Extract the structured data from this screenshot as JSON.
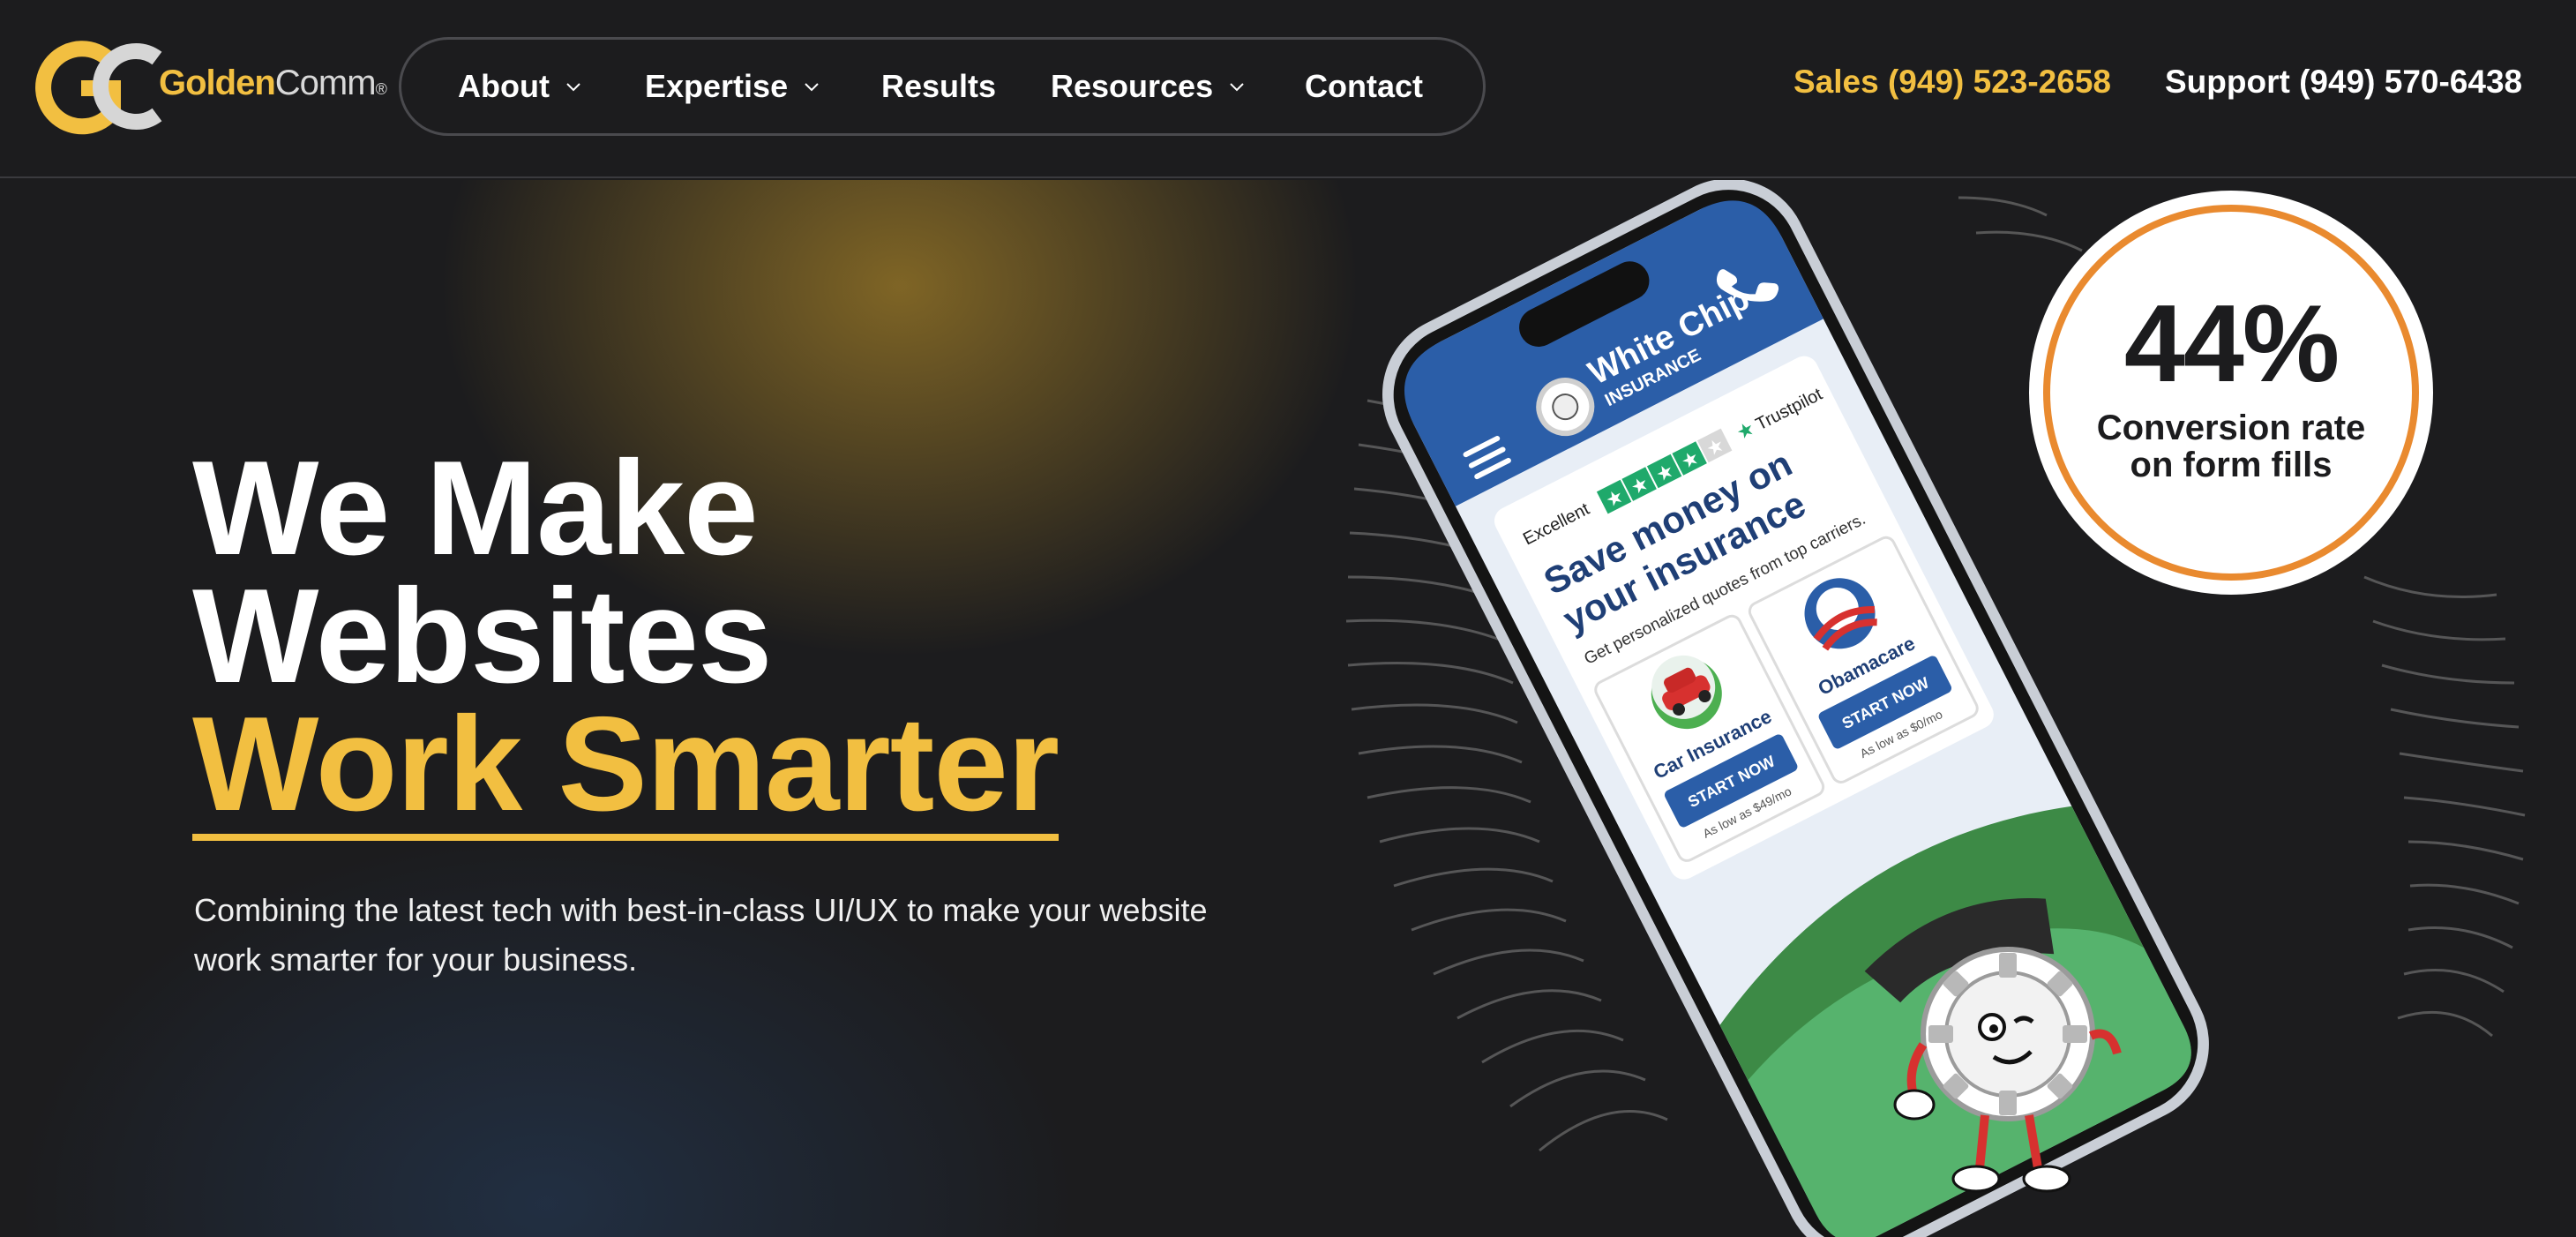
{
  "brand": {
    "name_gold": "Golden",
    "name_rest": "Comm",
    "registered": "®"
  },
  "nav": {
    "items": [
      {
        "label": "About",
        "has_dropdown": true
      },
      {
        "label": "Expertise",
        "has_dropdown": true
      },
      {
        "label": "Results",
        "has_dropdown": false
      },
      {
        "label": "Resources",
        "has_dropdown": true
      },
      {
        "label": "Contact",
        "has_dropdown": false
      }
    ]
  },
  "contact": {
    "sales": "Sales (949) 523-2658",
    "support": "Support (949) 570-6438"
  },
  "hero": {
    "headline_line1": "We Make",
    "headline_line2": "Websites",
    "headline_accent": "Work Smarter",
    "subcopy": "Combining the latest tech with best-in-class UI/UX to make your website work smarter for your business."
  },
  "stat": {
    "value": "44%",
    "label_line1": "Conversion rate",
    "label_line2": "on form fills"
  },
  "mockup": {
    "brand_line1": "White Chip",
    "brand_line2": "INSURANCE",
    "rating_label": "Excellent",
    "trustpilot": "Trustpilot",
    "headline_line1": "Save money on",
    "headline_line2": "your insurance",
    "subtext": "Get personalized quotes from top carriers.",
    "cards": [
      {
        "title": "Car Insurance",
        "button": "START NOW",
        "price": "As low as $49/mo"
      },
      {
        "title": "Obamacare",
        "button": "START NOW",
        "price": "As low as $0/mo"
      }
    ]
  },
  "colors": {
    "accent_gold": "#f2bf41",
    "background": "#1c1c1e",
    "stat_ring": "#e98a2f",
    "mockup_blue": "#2b5ea8",
    "trustpilot_green": "#1fa96b"
  }
}
